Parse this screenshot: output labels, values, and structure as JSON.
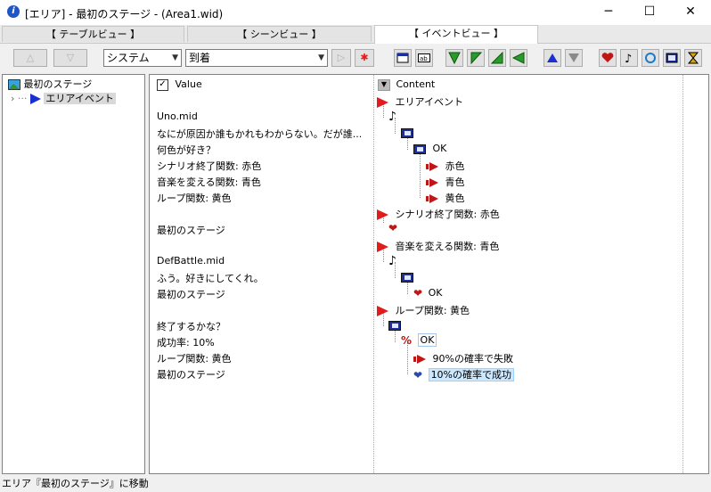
{
  "window": {
    "title": "[エリア] - 最初のステージ - (Area1.wid)",
    "minimize": "─",
    "maximize": "☐",
    "close": "✕"
  },
  "tabs": [
    {
      "label": "【 テーブルビュー 】"
    },
    {
      "label": "【 シーンビュー 】"
    },
    {
      "label": "【 イベントビュー 】"
    }
  ],
  "toolbar": {
    "up": "△",
    "down": "▽",
    "category_select": "システム",
    "event_select": "到着",
    "play": "▷",
    "star": "✱"
  },
  "tree": {
    "root": "最初のステージ",
    "child": "エリアイベント"
  },
  "value_column": {
    "header": "Value",
    "lines": [
      "Uno.mid",
      "なにが原因か誰もかれもわからない。だが誰...",
      "何色が好き？",
      "シナリオ終了関数: 赤色",
      "音楽を変える関数: 青色",
      "ループ関数: 黄色",
      "",
      "最初のステージ",
      "",
      "DefBattle.mid",
      "ふう。好きにしてくれ。",
      "最初のステージ",
      "",
      "終了するかな？",
      "成功率: 10%",
      "ループ関数: 黄色",
      "最初のステージ"
    ]
  },
  "content_column": {
    "header": "Content",
    "nodes": {
      "n0": "エリアイベント",
      "n3": "OK",
      "n4": "赤色",
      "n5": "青色",
      "n6": "黄色",
      "n7": "シナリオ終了関数: 赤色",
      "n9": "音楽を変える関数: 青色",
      "n12": "OK",
      "n13": "ループ関数: 黄色",
      "n15": "OK",
      "n16": "90%の確率で失敗",
      "n17": "10%の確率で成功"
    }
  },
  "status": "エリア『最初のステージ』に移動"
}
